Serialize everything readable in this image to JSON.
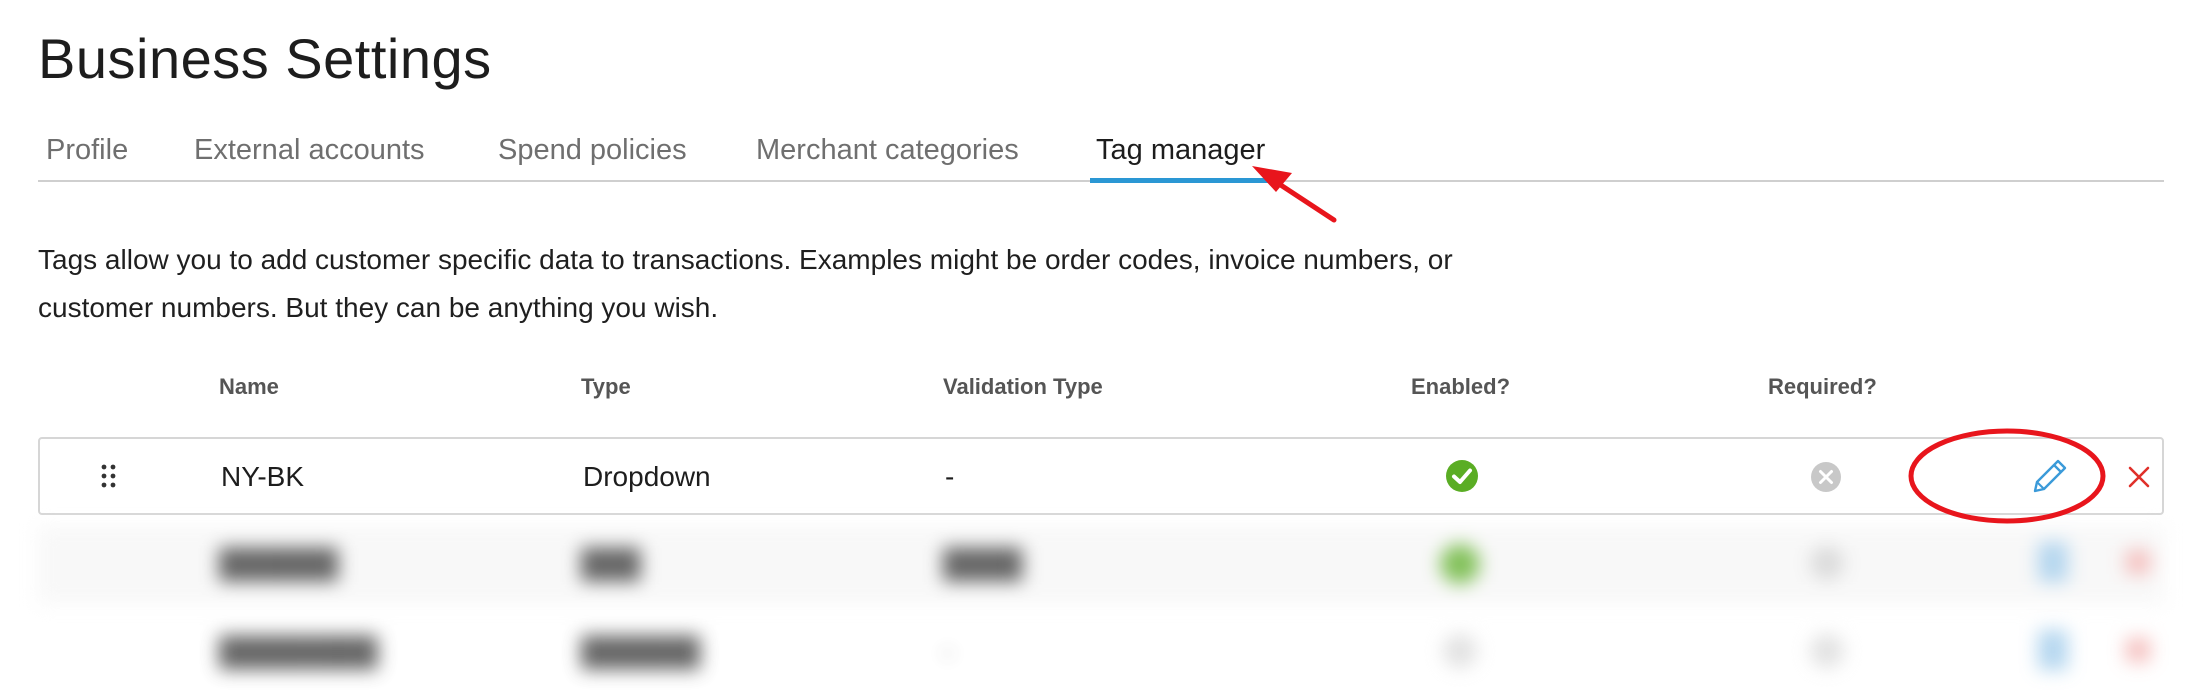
{
  "page": {
    "title": "Business Settings"
  },
  "tabs": [
    {
      "label": "Profile",
      "active": false
    },
    {
      "label": "External accounts",
      "active": false
    },
    {
      "label": "Spend policies",
      "active": false
    },
    {
      "label": "Merchant categories",
      "active": false
    },
    {
      "label": "Tag manager",
      "active": true
    }
  ],
  "description": "Tags allow you to add customer specific data to transactions. Examples might be order codes, invoice numbers, or customer numbers. But they can be anything you wish.",
  "table": {
    "headers": {
      "name": "Name",
      "type": "Type",
      "validation_type": "Validation Type",
      "enabled": "Enabled?",
      "required": "Required?"
    },
    "rows": [
      {
        "name": "NY-BK",
        "type": "Dropdown",
        "validation_type": "-",
        "enabled": true,
        "required": false
      }
    ],
    "blurred_rows": [
      {
        "name": "██████",
        "type": "███",
        "validation_type": "████"
      },
      {
        "name": "████████",
        "type": "██████",
        "validation_type": "-"
      }
    ]
  },
  "icons": {
    "drag": "drag-handle-icon",
    "enabled": "check-circle-icon",
    "required": "x-circle-icon",
    "edit": "pencil-icon",
    "delete": "close-icon"
  },
  "colors": {
    "accent": "#2a97d4",
    "enabled_green": "#5aad24",
    "disabled_grey": "#c8c8c8",
    "delete_red": "#e0302a",
    "annotation_red": "#e8151c"
  }
}
